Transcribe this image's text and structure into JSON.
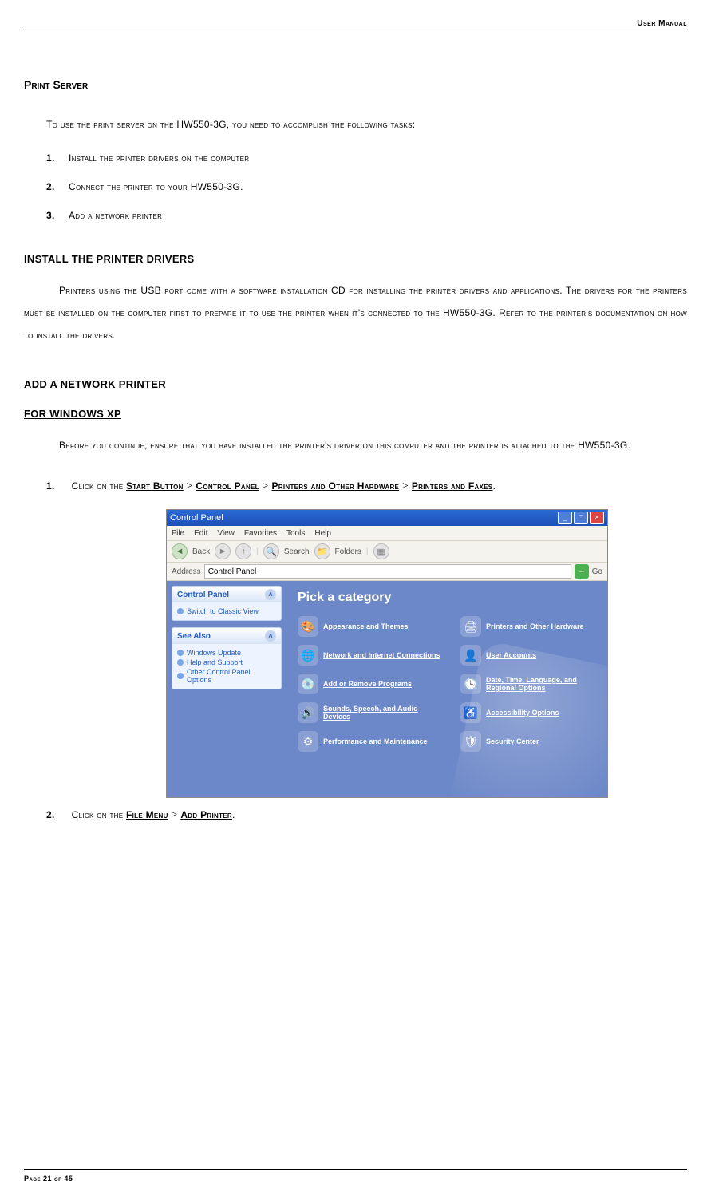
{
  "header": {
    "right": "User Manual"
  },
  "title": "Print Server",
  "intro": "To use the print server on the HW550-3G, you need to accomplish the following tasks:",
  "tasks": [
    {
      "n": "1.",
      "t": "Install the printer drivers on the computer"
    },
    {
      "n": "2.",
      "t": "Connect the printer to your HW550-3G."
    },
    {
      "n": "3.",
      "t": "Add a network printer"
    }
  ],
  "section_install": {
    "heading": "INSTALL THE PRINTER DRIVERS",
    "para": "Printers using the USB port come with a software installation CD for installing the printer drivers and applications. The drivers for the printers must be installed on the computer first to prepare it to use the printer when it's connected to the HW550-3G. Refer to the printer's documentation on how to install the drivers."
  },
  "section_add": {
    "heading": "ADD A NETWORK PRINTER",
    "sub": "FOR WINDOWS XP",
    "para": "Before you continue, ensure that you have installed the printer's driver on this computer and the printer is attached to the HW550-3G."
  },
  "steps": [
    {
      "n": "1.",
      "pre": "Click on the ",
      "parts": [
        "Start Button",
        "Control Panel",
        "Printers and Other Hardware",
        "Printers and Faxes"
      ],
      "post": "."
    },
    {
      "n": "2.",
      "pre": "Click on the ",
      "parts": [
        "File Menu",
        "Add Printer"
      ],
      "post": "."
    }
  ],
  "cp": {
    "title": "Control Panel",
    "menus": [
      "File",
      "Edit",
      "View",
      "Favorites",
      "Tools",
      "Help"
    ],
    "toolbar": {
      "back": "Back",
      "search": "Search",
      "folders": "Folders"
    },
    "address_label": "Address",
    "address_value": "Control Panel",
    "go": "Go",
    "sidebar": {
      "box1": {
        "title": "Control Panel",
        "item": "Switch to Classic View"
      },
      "box2": {
        "title": "See Also",
        "items": [
          "Windows Update",
          "Help and Support",
          "Other Control Panel Options"
        ]
      }
    },
    "pick": "Pick a category",
    "cats": [
      {
        "label": "Appearance and Themes",
        "icon": "🎨"
      },
      {
        "label": "Printers and Other Hardware",
        "icon": "🖨"
      },
      {
        "label": "Network and Internet Connections",
        "icon": "🌐"
      },
      {
        "label": "User Accounts",
        "icon": "👤"
      },
      {
        "label": "Add or Remove Programs",
        "icon": "💿"
      },
      {
        "label": "Date, Time, Language, and Regional Options",
        "icon": "🕒"
      },
      {
        "label": "Sounds, Speech, and Audio Devices",
        "icon": "🔊"
      },
      {
        "label": "Accessibility Options",
        "icon": "♿"
      },
      {
        "label": "Performance and Maintenance",
        "icon": "⚙"
      },
      {
        "label": "Security Center",
        "icon": "🛡"
      }
    ]
  },
  "footer": "Page 21 of 45"
}
